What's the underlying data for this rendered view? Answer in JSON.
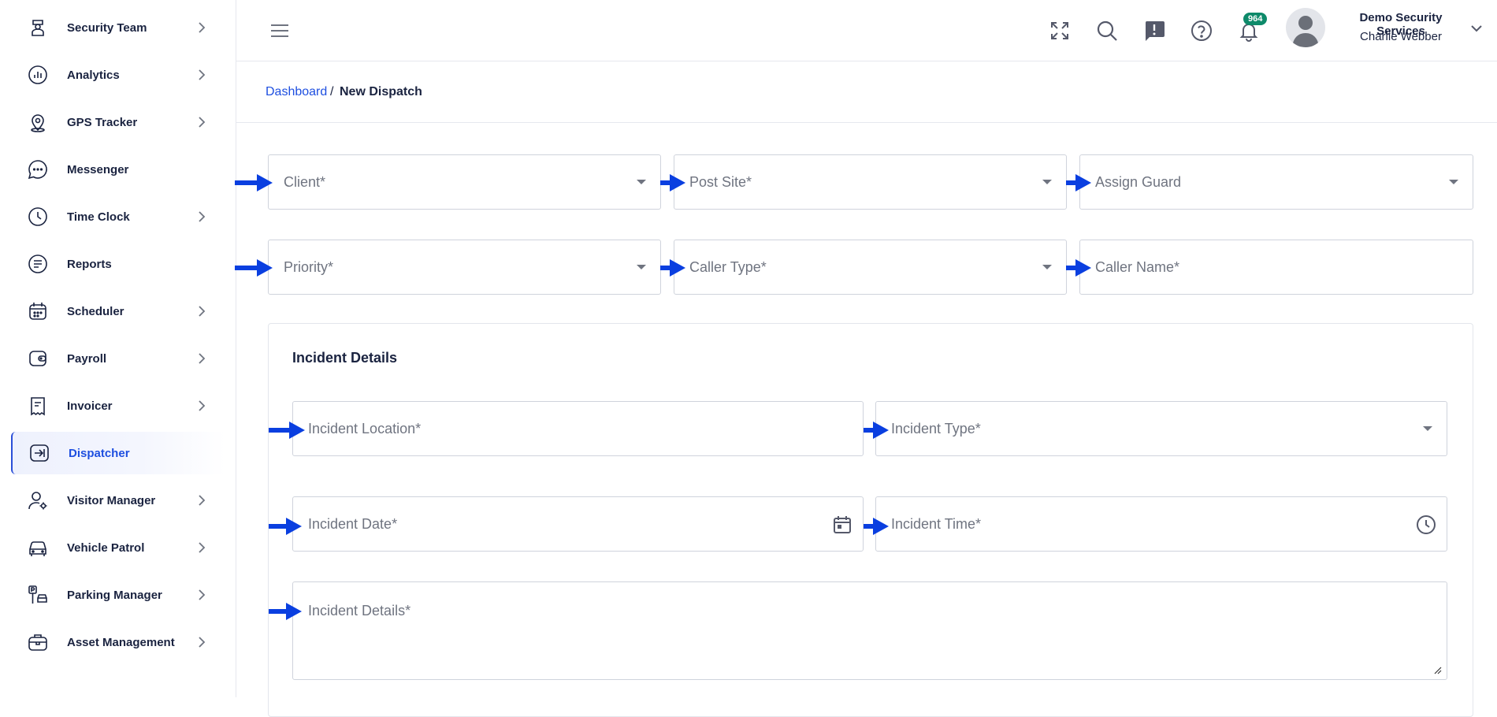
{
  "sidebar": {
    "items": [
      {
        "label": "Security Team",
        "icon": "security-guard-icon",
        "chevron": true
      },
      {
        "label": "Analytics",
        "icon": "analytics-icon",
        "chevron": true
      },
      {
        "label": "GPS Tracker",
        "icon": "map-pin-icon",
        "chevron": true
      },
      {
        "label": "Messenger",
        "icon": "chat-bubble-icon",
        "chevron": false
      },
      {
        "label": "Time Clock",
        "icon": "clock-icon",
        "chevron": true
      },
      {
        "label": "Reports",
        "icon": "report-icon",
        "chevron": false
      },
      {
        "label": "Scheduler",
        "icon": "calendar-icon",
        "chevron": true
      },
      {
        "label": "Payroll",
        "icon": "wallet-icon",
        "chevron": true
      },
      {
        "label": "Invoicer",
        "icon": "receipt-icon",
        "chevron": true
      },
      {
        "label": "Dispatcher",
        "icon": "dispatch-icon",
        "chevron": false,
        "active": true
      },
      {
        "label": "Visitor Manager",
        "icon": "visitor-gear-icon",
        "chevron": true
      },
      {
        "label": "Vehicle Patrol",
        "icon": "car-icon",
        "chevron": true
      },
      {
        "label": "Parking Manager",
        "icon": "parking-icon",
        "chevron": true
      },
      {
        "label": "Asset Management",
        "icon": "briefcase-icon",
        "chevron": true
      }
    ]
  },
  "header": {
    "notification_count": "964",
    "org_name": "Demo Security Services",
    "user_name": "Charlie Webber",
    "icons": [
      "menu-icon",
      "fullscreen-icon",
      "search-icon",
      "feedback-icon",
      "help-icon",
      "bell-icon",
      "chevron-down-icon"
    ]
  },
  "breadcrumb": {
    "root": "Dashboard",
    "separator": "/",
    "current": "New Dispatch"
  },
  "form": {
    "client": "Client*",
    "post_site": "Post Site*",
    "assign_guard": "Assign Guard",
    "priority": "Priority*",
    "caller_type": "Caller Type*",
    "caller_name": "Caller Name*"
  },
  "incident": {
    "title": "Incident Details",
    "location": "Incident Location*",
    "type": "Incident Type*",
    "date": "Incident Date*",
    "time": "Incident Time*",
    "details": "Incident Details*"
  },
  "colors": {
    "accent": "#1e4fe0",
    "arrow": "#0a3fe0",
    "text_dark": "#1a2340",
    "placeholder": "#6f7480",
    "badge": "#0e8a6a"
  }
}
